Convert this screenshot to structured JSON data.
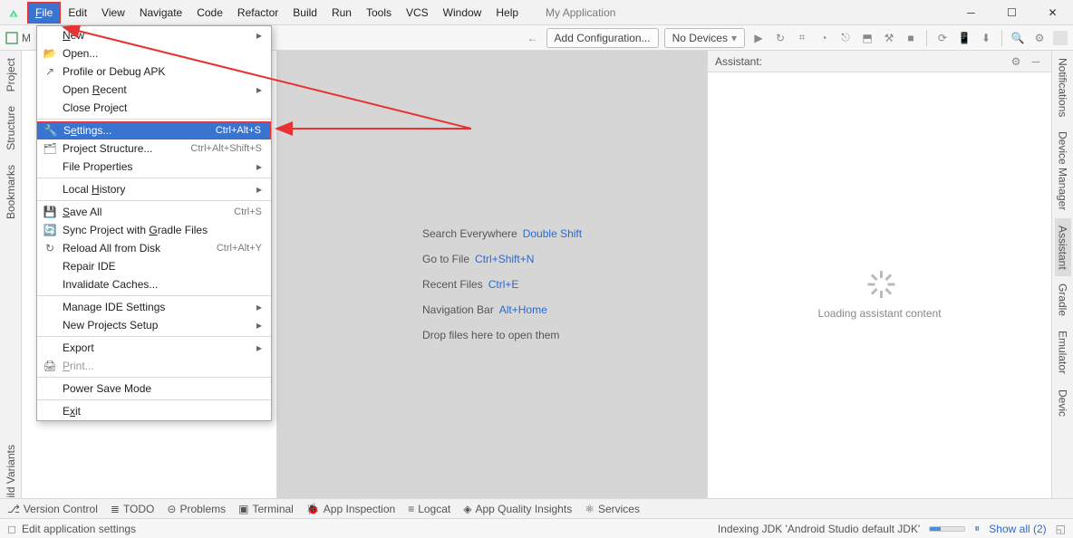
{
  "menubar": {
    "items": [
      "File",
      "Edit",
      "View",
      "Navigate",
      "Code",
      "Refactor",
      "Build",
      "Run",
      "Tools",
      "VCS",
      "Window",
      "Help"
    ],
    "project_name": "My Application"
  },
  "toolbar": {
    "tab_label": "M",
    "add_config": "Add Configuration...",
    "no_devices": "No Devices"
  },
  "file_menu": {
    "new": "New",
    "open": "Open...",
    "profile": "Profile or Debug APK",
    "open_recent": "Open Recent",
    "close_project": "Close Project",
    "settings": "Settings...",
    "settings_shortcut": "Ctrl+Alt+S",
    "proj_struct": "Project Structure...",
    "proj_struct_shortcut": "Ctrl+Alt+Shift+S",
    "file_props": "File Properties",
    "local_history": "Local History",
    "save_all": "Save All",
    "save_all_shortcut": "Ctrl+S",
    "sync": "Sync Project with Gradle Files",
    "reload": "Reload All from Disk",
    "reload_shortcut": "Ctrl+Alt+Y",
    "repair": "Repair IDE",
    "invalidate": "Invalidate Caches...",
    "manage_ide": "Manage IDE Settings",
    "new_projects": "New Projects Setup",
    "export": "Export",
    "print": "Print...",
    "power_save": "Power Save Mode",
    "exit": "Exit"
  },
  "editor_hints": {
    "search": "Search Everywhere",
    "search_key": "Double Shift",
    "goto": "Go to File",
    "goto_key": "Ctrl+Shift+N",
    "recent": "Recent Files",
    "recent_key": "Ctrl+E",
    "nav": "Navigation Bar",
    "nav_key": "Alt+Home",
    "drop": "Drop files here to open them"
  },
  "assistant": {
    "title": "Assistant:",
    "loading": "Loading assistant content"
  },
  "left_strip": [
    "Project",
    "Structure",
    "Bookmarks",
    "Build Variants"
  ],
  "right_strip": [
    "Notifications",
    "Device Manager",
    "Assistant",
    "Gradle",
    "Emulator",
    "Devic"
  ],
  "bottom": {
    "version_control": "Version Control",
    "todo": "TODO",
    "problems": "Problems",
    "terminal": "Terminal",
    "app_inspection": "App Inspection",
    "logcat": "Logcat",
    "quality": "App Quality Insights",
    "services": "Services"
  },
  "status": {
    "left": "Edit application settings",
    "indexing": "Indexing JDK 'Android Studio default JDK'",
    "show_all": "Show all (2)"
  }
}
